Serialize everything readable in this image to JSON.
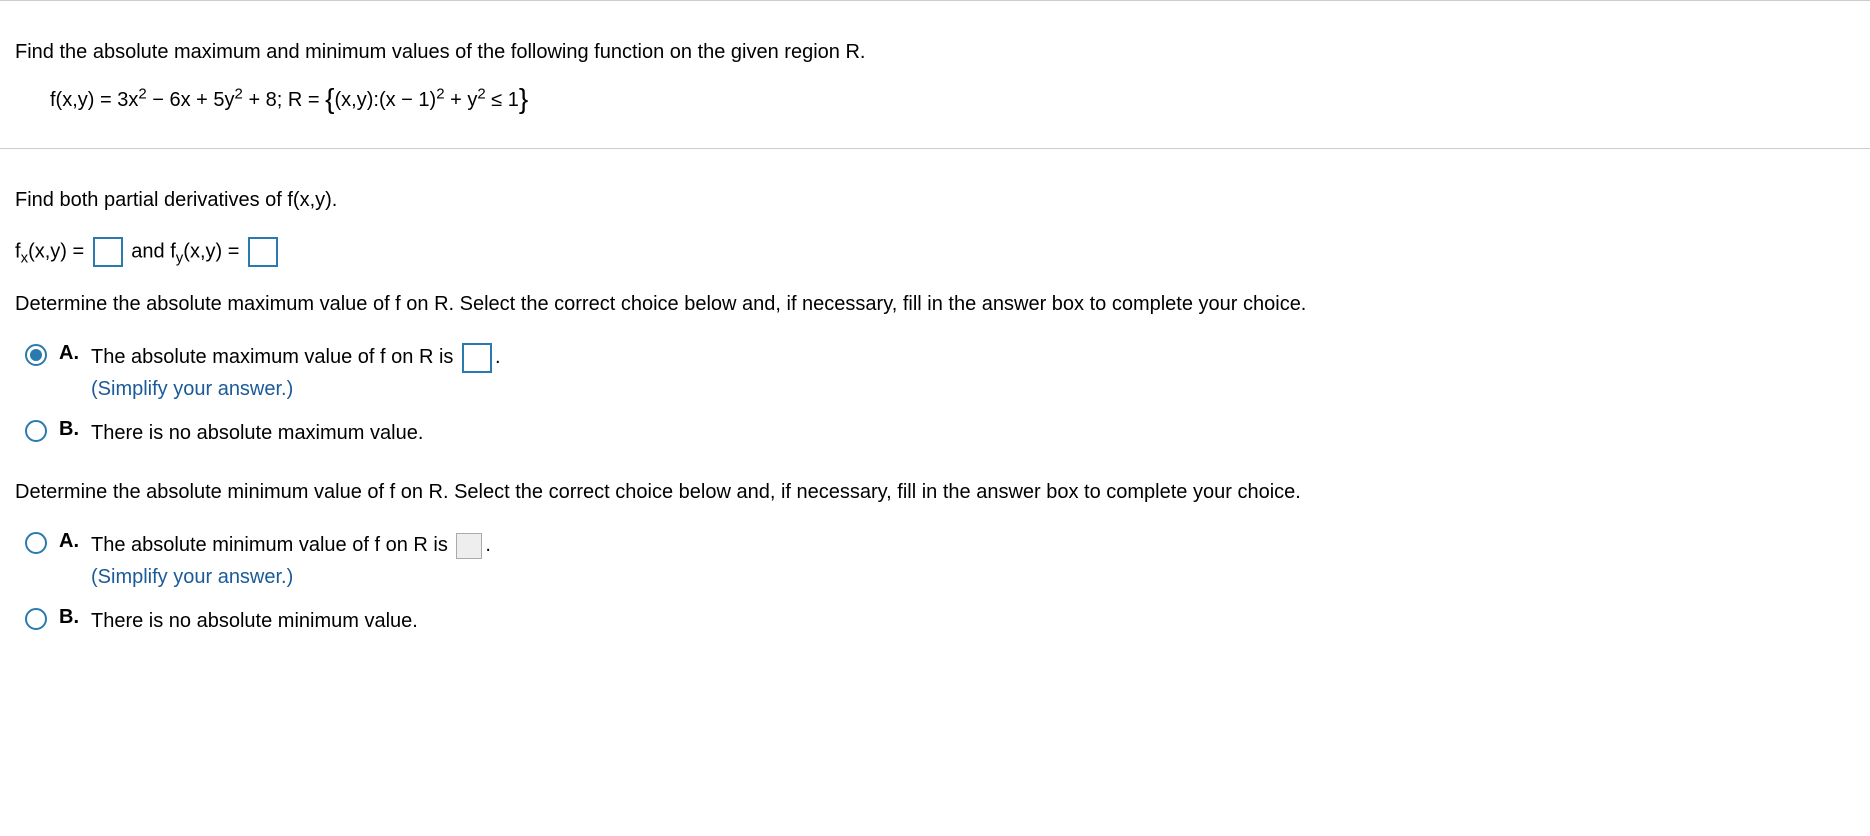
{
  "problem": {
    "intro": "Find the absolute maximum and minimum values of the following function on the given region R.",
    "func_prefix": "f(x,y) = 3x",
    "func_mid1": " − 6x + 5y",
    "func_mid2": " + 8; R = ",
    "region_inner1": "(x,y):(x − 1)",
    "region_inner2": " + y",
    "region_inner3": " ≤ 1"
  },
  "partials": {
    "prompt": "Find both partial derivatives of f(x,y).",
    "fx_label_pre": "f",
    "fx_label_sub": "x",
    "fx_label_post": "(x,y) = ",
    "join": " and f",
    "fy_label_sub": "y",
    "fy_label_post": "(x,y) = "
  },
  "max": {
    "prompt": "Determine the absolute maximum value of f on R. Select the correct choice below and, if necessary, fill in the answer box to complete your choice.",
    "A_label": "A.",
    "A_text_pre": "The absolute maximum value of f on R is ",
    "A_text_post": ".",
    "A_hint": "(Simplify your answer.)",
    "B_label": "B.",
    "B_text": "There is no absolute maximum value."
  },
  "min": {
    "prompt": "Determine the absolute minimum value of f on R. Select the correct choice below and, if necessary, fill in the answer box to complete your choice.",
    "A_label": "A.",
    "A_text_pre": "The absolute minimum value of f on R is ",
    "A_text_post": ".",
    "A_hint": "(Simplify your answer.)",
    "B_label": "B.",
    "B_text": "There is no absolute minimum value."
  }
}
